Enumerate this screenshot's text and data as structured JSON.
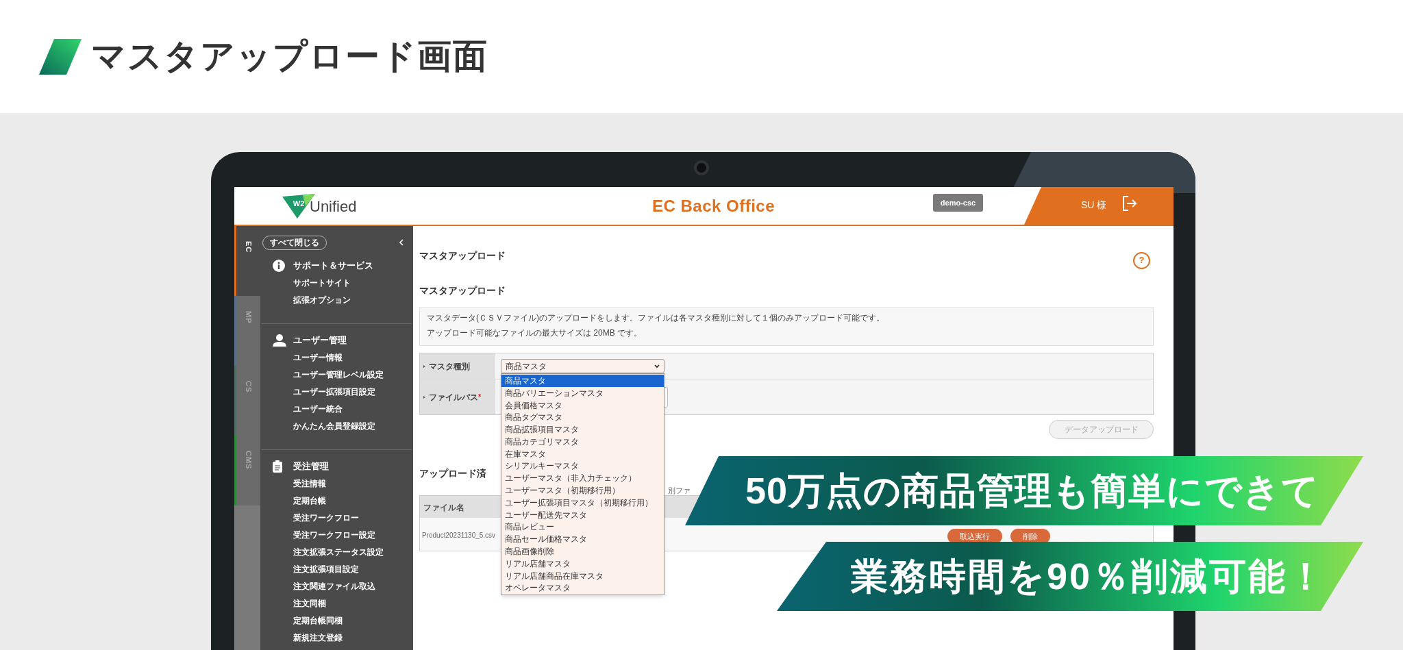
{
  "page_title": "マスタアップロード画面",
  "app": {
    "logo": {
      "badge": "W2",
      "name": "Unified"
    },
    "title": "EC Back Office",
    "environment": "demo-csc",
    "user": "SU 様"
  },
  "sidebar": {
    "tabs": [
      {
        "label": "EC",
        "selected": true,
        "color": "#e07020"
      },
      {
        "label": "MP",
        "selected": false,
        "color": "#5b6f8a"
      },
      {
        "label": "CS",
        "selected": false,
        "color": "#4f6f66"
      },
      {
        "label": "CMS",
        "selected": false,
        "color": "#2f8a3a"
      }
    ],
    "collapse_all": "すべて閉じる",
    "groups": [
      {
        "title": "サポート＆サービス",
        "items": [
          "サポートサイト",
          "拡張オプション"
        ]
      },
      {
        "title": "ユーザー管理",
        "items": [
          "ユーザー情報",
          "ユーザー管理レベル設定",
          "ユーザー拡張項目設定",
          "ユーザー統合",
          "かんたん会員登録設定"
        ]
      },
      {
        "title": "受注管理",
        "items": [
          "受注情報",
          "定期台帳",
          "受注ワークフロー",
          "受注ワークフロー設定",
          "注文拡張ステータス設定",
          "注文拡張項目設定",
          "注文関連ファイル取込",
          "注文同梱",
          "定期台帳同梱",
          "新規注文登録"
        ]
      }
    ]
  },
  "main": {
    "title": "マスタアップロード",
    "help": "?",
    "section_title": "マスタアップロード",
    "notice": [
      "マスタデータ(ＣＳＶファイル)のアップロードをします。ファイルは各マスタ種別に対して１個のみアップロード可能です。",
      "アップロード可能なファイルの最大サイズは 20MB です。"
    ],
    "form": [
      {
        "kind": "select",
        "label": "マスタ種別",
        "value": "商品マスタ",
        "expanded": true,
        "options": [
          {
            "label": "商品マスタ",
            "selected": true
          },
          {
            "label": "商品バリエーションマスタ",
            "selected": false
          },
          {
            "label": "会員価格マスタ",
            "selected": false
          },
          {
            "label": "商品タグマスタ",
            "selected": false
          },
          {
            "label": "商品拡張項目マスタ",
            "selected": false
          },
          {
            "label": "商品カテゴリマスタ",
            "selected": false
          },
          {
            "label": "在庫マスタ",
            "selected": false
          },
          {
            "label": "シリアルキーマスタ",
            "selected": false
          },
          {
            "label": "ユーザーマスタ（非入力チェック）",
            "selected": false
          },
          {
            "label": "ユーザーマスタ（初期移行用）",
            "selected": false
          },
          {
            "label": "ユーザー拡張項目マスタ（初期移行用）",
            "selected": false
          },
          {
            "label": "ユーザー配送先マスタ",
            "selected": false
          },
          {
            "label": "商品レビュー",
            "selected": false
          },
          {
            "label": "商品セール価格マスタ",
            "selected": false
          },
          {
            "label": "商品画像削除",
            "selected": false
          },
          {
            "label": "リアル店舗マスタ",
            "selected": false
          },
          {
            "label": "リアル店舗商品在庫マスタ",
            "selected": false
          },
          {
            "label": "オペレータマスタ",
            "selected": false
          }
        ]
      },
      {
        "kind": "file",
        "label": "ファイルパス",
        "required_mark": "*"
      }
    ],
    "upload_button": {
      "label": "データアップロード",
      "disabled": true
    },
    "uploaded": {
      "title": "アップロード済",
      "note": "別ファ",
      "columns": [
        "ファイル名"
      ],
      "rows": [
        {
          "file": "Product20231130_5.csv",
          "actions": [
            "取込実行",
            "削除"
          ]
        }
      ]
    }
  },
  "banners": [
    "50万点の商品管理も簡単にできて",
    "業務時間を90％削減可能！"
  ]
}
